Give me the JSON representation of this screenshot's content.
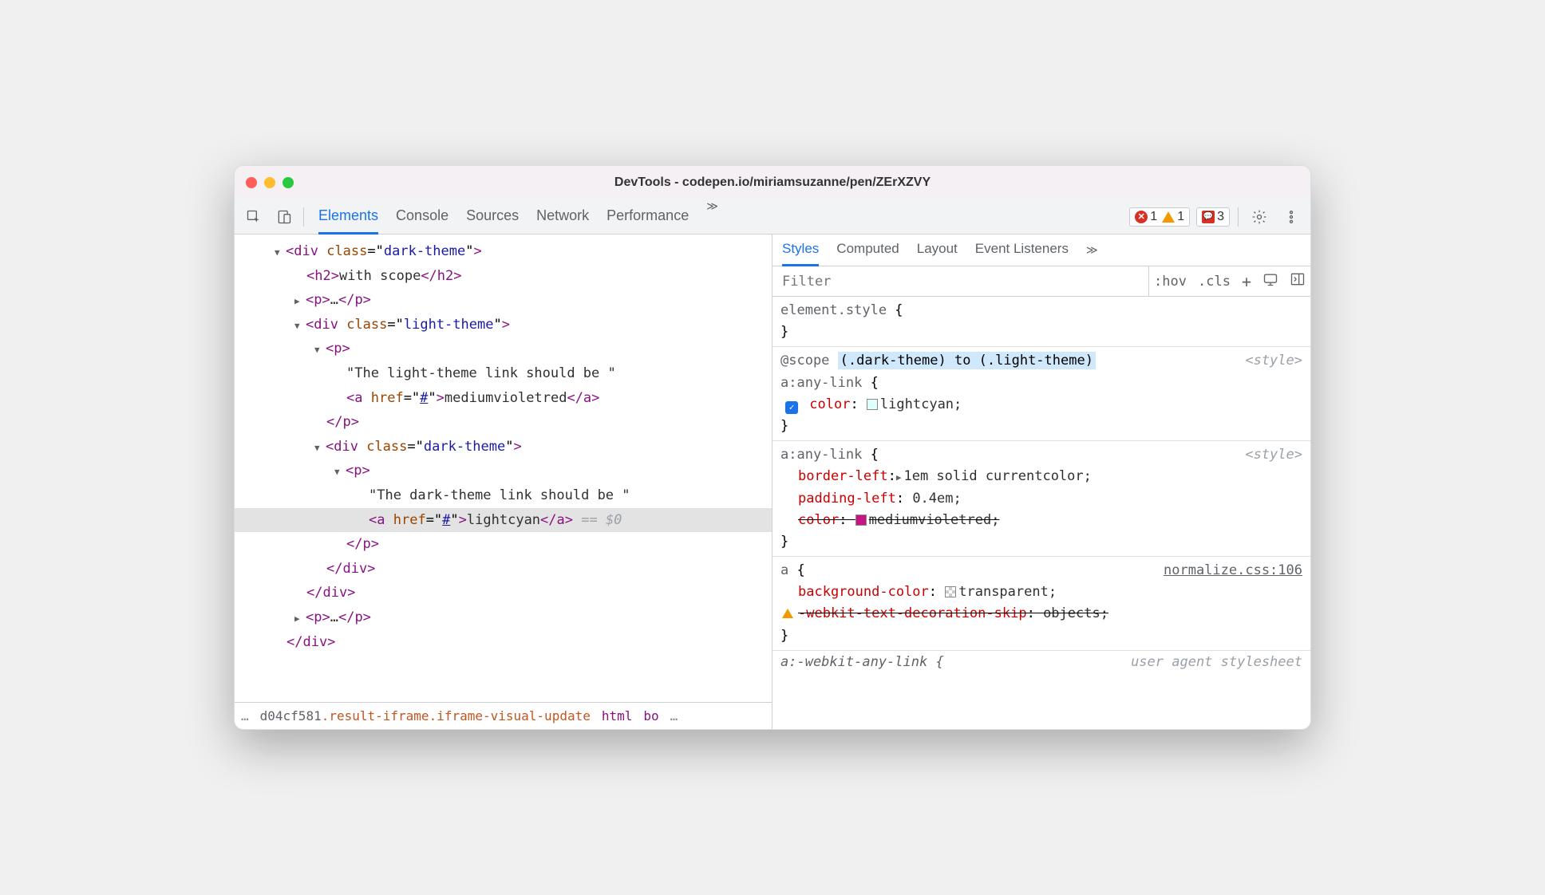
{
  "window": {
    "title": "DevTools - codepen.io/miriamsuzanne/pen/ZErXZVY"
  },
  "tabs": {
    "main": [
      "Elements",
      "Console",
      "Sources",
      "Network",
      "Performance"
    ],
    "active": "Elements",
    "sub": [
      "Styles",
      "Computed",
      "Layout",
      "Event Listeners"
    ],
    "sub_active": "Styles"
  },
  "badges": {
    "errors": "1",
    "warnings": "1",
    "issues": "3"
  },
  "filter": {
    "placeholder": "Filter",
    "hov": ":hov",
    "cls": ".cls"
  },
  "dom": {
    "l1_open": "<div class=\"dark-theme\">",
    "l2": {
      "open": "<h2>",
      "text": "with scope",
      "close": "</h2>"
    },
    "l3": {
      "open": "<p>",
      "text": "…",
      "close": "</p>"
    },
    "l4_open": "<div class=\"light-theme\">",
    "l5_open": "<p>",
    "l6_text": "\"The light-theme link should be \"",
    "l7": {
      "open": "<a href=\"#\">",
      "text": "mediumvioletred",
      "close": "</a>"
    },
    "l8_close": "</p>",
    "l9_open": "<div class=\"dark-theme\">",
    "l10_open": "<p>",
    "l11_text": "\"The dark-theme link should be \"",
    "l12": {
      "open": "<a href=\"#\">",
      "text": "lightcyan",
      "close": "</a>",
      "eq": " == $0"
    },
    "l13_close": "</p>",
    "l14_close": "</div>",
    "l15_close": "</div>",
    "l16": {
      "open": "<p>",
      "text": "…",
      "close": "</p>"
    },
    "l17_close": "</div>"
  },
  "breadcrumb": {
    "dots": "…",
    "seg1": "d04cf581",
    "seg2": ".result-iframe.iframe-visual-update",
    "seg3": "html",
    "seg4": "bo"
  },
  "styles": {
    "element_style": {
      "selector": "element.style",
      "open": " {",
      "close": "}"
    },
    "rule1": {
      "scope": "@scope",
      "scope_hl": "(.dark-theme) to (.light-theme)",
      "selector": "a:any-link",
      "open": " {",
      "prop": "color",
      "val": "lightcyan",
      "close": "}",
      "src": "<style>"
    },
    "rule2": {
      "selector": "a:any-link",
      "open": " {",
      "p1": {
        "name": "border-left",
        "val": "1em solid currentcolor"
      },
      "p2": {
        "name": "padding-left",
        "val": "0.4em"
      },
      "p3": {
        "name": "color",
        "val": "mediumvioletred"
      },
      "close": "}",
      "src": "<style>"
    },
    "rule3": {
      "selector": "a",
      "open": " {",
      "p1": {
        "name": "background-color",
        "val": "transparent"
      },
      "p2": {
        "name": "-webkit-text-decoration-skip",
        "val": "objects"
      },
      "close": "}",
      "src": "normalize.css:106"
    },
    "rule4": {
      "selector": "a:-webkit-any-link {",
      "src": "user agent stylesheet"
    }
  }
}
